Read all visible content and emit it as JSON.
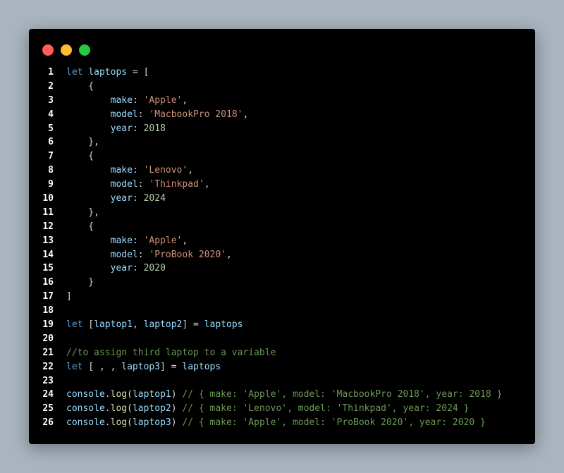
{
  "colors": {
    "page_background": "#a9b4bf",
    "window_background": "#000000",
    "dot_red": "#ff5f57",
    "dot_yellow": "#febc2e",
    "dot_green": "#28c840",
    "keyword": "#569cd6",
    "variable": "#9cdcfe",
    "string": "#ce9178",
    "number": "#b5cea8",
    "comment": "#6a9955"
  },
  "code": [
    {
      "n": "1",
      "tokens": [
        [
          "kw",
          "let"
        ],
        [
          "punc",
          " "
        ],
        [
          "var",
          "laptops"
        ],
        [
          "punc",
          " = ["
        ]
      ]
    },
    {
      "n": "2",
      "tokens": [
        [
          "punc",
          "    {"
        ]
      ]
    },
    {
      "n": "3",
      "tokens": [
        [
          "punc",
          "        "
        ],
        [
          "prop",
          "make"
        ],
        [
          "punc",
          ": "
        ],
        [
          "str",
          "'Apple'"
        ],
        [
          "punc",
          ","
        ]
      ]
    },
    {
      "n": "4",
      "tokens": [
        [
          "punc",
          "        "
        ],
        [
          "prop",
          "model"
        ],
        [
          "punc",
          ": "
        ],
        [
          "str",
          "'MacbookPro 2018'"
        ],
        [
          "punc",
          ","
        ]
      ]
    },
    {
      "n": "5",
      "tokens": [
        [
          "punc",
          "        "
        ],
        [
          "prop",
          "year"
        ],
        [
          "punc",
          ": "
        ],
        [
          "num",
          "2018"
        ]
      ]
    },
    {
      "n": "6",
      "tokens": [
        [
          "punc",
          "    },"
        ]
      ]
    },
    {
      "n": "7",
      "tokens": [
        [
          "punc",
          "    {"
        ]
      ]
    },
    {
      "n": "8",
      "tokens": [
        [
          "punc",
          "        "
        ],
        [
          "prop",
          "make"
        ],
        [
          "punc",
          ": "
        ],
        [
          "str",
          "'Lenovo'"
        ],
        [
          "punc",
          ","
        ]
      ]
    },
    {
      "n": "9",
      "tokens": [
        [
          "punc",
          "        "
        ],
        [
          "prop",
          "model"
        ],
        [
          "punc",
          ": "
        ],
        [
          "str",
          "'Thinkpad'"
        ],
        [
          "punc",
          ","
        ]
      ]
    },
    {
      "n": "10",
      "tokens": [
        [
          "punc",
          "        "
        ],
        [
          "prop",
          "year"
        ],
        [
          "punc",
          ": "
        ],
        [
          "num",
          "2024"
        ]
      ]
    },
    {
      "n": "11",
      "tokens": [
        [
          "punc",
          "    },"
        ]
      ]
    },
    {
      "n": "12",
      "tokens": [
        [
          "punc",
          "    {"
        ]
      ]
    },
    {
      "n": "13",
      "tokens": [
        [
          "punc",
          "        "
        ],
        [
          "prop",
          "make"
        ],
        [
          "punc",
          ": "
        ],
        [
          "str",
          "'Apple'"
        ],
        [
          "punc",
          ","
        ]
      ]
    },
    {
      "n": "14",
      "tokens": [
        [
          "punc",
          "        "
        ],
        [
          "prop",
          "model"
        ],
        [
          "punc",
          ": "
        ],
        [
          "str",
          "'ProBook 2020'"
        ],
        [
          "punc",
          ","
        ]
      ]
    },
    {
      "n": "15",
      "tokens": [
        [
          "punc",
          "        "
        ],
        [
          "prop",
          "year"
        ],
        [
          "punc",
          ": "
        ],
        [
          "num",
          "2020"
        ]
      ]
    },
    {
      "n": "16",
      "tokens": [
        [
          "punc",
          "    }"
        ]
      ]
    },
    {
      "n": "17",
      "tokens": [
        [
          "punc",
          "]"
        ]
      ]
    },
    {
      "n": "18",
      "tokens": []
    },
    {
      "n": "19",
      "tokens": [
        [
          "kw",
          "let"
        ],
        [
          "punc",
          " ["
        ],
        [
          "var",
          "laptop1"
        ],
        [
          "punc",
          ", "
        ],
        [
          "var",
          "laptop2"
        ],
        [
          "punc",
          "] = "
        ],
        [
          "var",
          "laptops"
        ]
      ]
    },
    {
      "n": "20",
      "tokens": []
    },
    {
      "n": "21",
      "tokens": [
        [
          "com",
          "//to assign third laptop to a variable"
        ]
      ]
    },
    {
      "n": "22",
      "tokens": [
        [
          "kw",
          "let"
        ],
        [
          "punc",
          " [ , , "
        ],
        [
          "var",
          "laptop3"
        ],
        [
          "punc",
          "] = "
        ],
        [
          "var",
          "laptops"
        ]
      ]
    },
    {
      "n": "23",
      "tokens": []
    },
    {
      "n": "24",
      "tokens": [
        [
          "var",
          "console"
        ],
        [
          "punc",
          "."
        ],
        [
          "fn",
          "log"
        ],
        [
          "punc",
          "("
        ],
        [
          "var",
          "laptop1"
        ],
        [
          "punc",
          ") "
        ],
        [
          "com",
          "// { make: 'Apple', model: 'MacbookPro 2018', year: 2018 }"
        ]
      ]
    },
    {
      "n": "25",
      "tokens": [
        [
          "var",
          "console"
        ],
        [
          "punc",
          "."
        ],
        [
          "fn",
          "log"
        ],
        [
          "punc",
          "("
        ],
        [
          "var",
          "laptop2"
        ],
        [
          "punc",
          ") "
        ],
        [
          "com",
          "// { make: 'Lenovo', model: 'Thinkpad', year: 2024 }"
        ]
      ]
    },
    {
      "n": "26",
      "tokens": [
        [
          "var",
          "console"
        ],
        [
          "punc",
          "."
        ],
        [
          "fn",
          "log"
        ],
        [
          "punc",
          "("
        ],
        [
          "var",
          "laptop3"
        ],
        [
          "punc",
          ") "
        ],
        [
          "com",
          "// { make: 'Apple', model: 'ProBook 2020', year: 2020 }"
        ]
      ]
    }
  ]
}
